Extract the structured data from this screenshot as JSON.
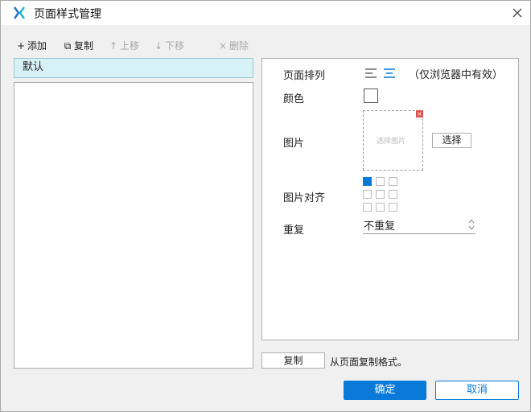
{
  "window": {
    "title": "页面样式管理",
    "accent_color": "#0a7ad8",
    "icons": {
      "logo": "axure-x-icon",
      "close": "close-icon"
    }
  },
  "toolbar": {
    "add_label": "添加",
    "copy_label": "复制",
    "move_up_label": "上移",
    "move_down_label": "下移",
    "delete_label": "删除",
    "add_glyph": "+",
    "copy_glyph": "⧉",
    "up_glyph": "↑",
    "down_glyph": "↓",
    "delete_glyph": "×"
  },
  "style_list": {
    "items": [
      {
        "label": "默认",
        "selected": true
      }
    ]
  },
  "properties": {
    "page_align_label": "页面排列",
    "page_align_note": "（仅浏览器中有效）",
    "page_align_selected": "center",
    "color_label": "颜色",
    "image_label": "图片",
    "image_placeholder": "选择图片",
    "image_delete_glyph": "×",
    "select_button": "选择",
    "image_align_label": "图片对齐",
    "image_align_selected": "top-left",
    "repeat_label": "重复",
    "repeat_value": "不重复"
  },
  "footer": {
    "copy_button": "复制",
    "copy_hint": "从页面复制格式。",
    "ok_button": "确定",
    "cancel_button": "取消"
  }
}
